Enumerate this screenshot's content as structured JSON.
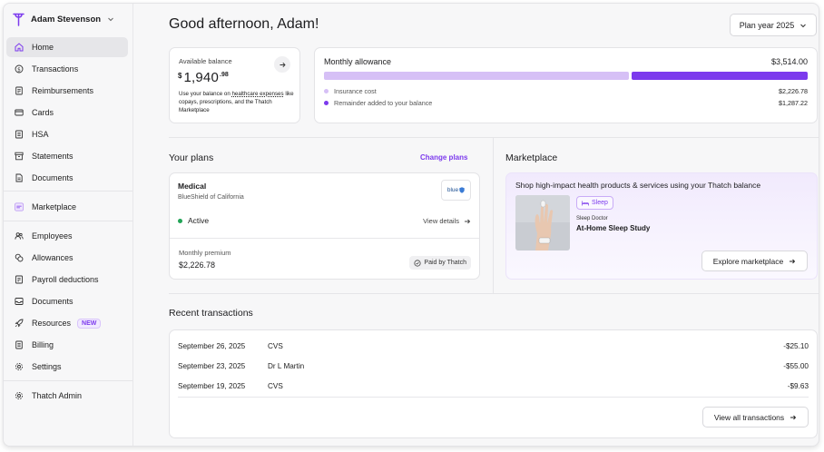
{
  "user": {
    "name": "Adam Stevenson"
  },
  "sidebar": {
    "group1": [
      {
        "label": "Home",
        "icon": "home-icon",
        "active": true
      },
      {
        "label": "Transactions",
        "icon": "dollar-circle-icon"
      },
      {
        "label": "Reimbursements",
        "icon": "receipt-icon"
      },
      {
        "label": "Cards",
        "icon": "card-icon"
      },
      {
        "label": "HSA",
        "icon": "hsa-icon"
      },
      {
        "label": "Statements",
        "icon": "archive-icon"
      },
      {
        "label": "Documents",
        "icon": "document-icon"
      }
    ],
    "group2": [
      {
        "label": "Marketplace",
        "icon": "marketplace-icon"
      }
    ],
    "group3": [
      {
        "label": "Employees",
        "icon": "users-icon"
      },
      {
        "label": "Allowances",
        "icon": "coins-icon"
      },
      {
        "label": "Payroll deductions",
        "icon": "payroll-icon"
      },
      {
        "label": "Documents",
        "icon": "inbox-icon"
      },
      {
        "label": "Resources",
        "icon": "rocket-icon",
        "badge": "NEW"
      },
      {
        "label": "Billing",
        "icon": "billing-icon"
      },
      {
        "label": "Settings",
        "icon": "gear-icon"
      }
    ],
    "group4": [
      {
        "label": "Thatch Admin",
        "icon": "admin-gear-icon"
      }
    ]
  },
  "header": {
    "greeting": "Good afternoon, Adam!",
    "plan_year": "Plan year 2025"
  },
  "balance": {
    "label": "Available balance",
    "currency": "$",
    "whole": "1,940",
    "cents": ".98",
    "desc_before": "Use your balance on ",
    "desc_link": "healthcare expenses",
    "desc_after": " like copays, prescriptions, and the Thatch Marketplace"
  },
  "allowance": {
    "title": "Monthly allowance",
    "total": "$3,514.00",
    "rows": [
      {
        "label": "Insurance cost",
        "value": "$2,226.78",
        "color": "#d6c0f6",
        "share": 0.634
      },
      {
        "label": "Remainder added to your balance",
        "value": "$1,287.22",
        "color": "#7c3aed",
        "share": 0.366
      }
    ]
  },
  "plans": {
    "title": "Your plans",
    "change_label": "Change plans",
    "plan": {
      "name": "Medical",
      "carrier": "BlueShield of California",
      "carrier_logo_text": "blue",
      "status": "Active",
      "view_details": "View details",
      "premium_label": "Monthly premium",
      "premium_value": "$2,226.78",
      "paid_by": "Paid by Thatch"
    }
  },
  "marketplace": {
    "title": "Marketplace",
    "headline": "Shop high-impact health products & services using your Thatch balance",
    "tag": "Sleep",
    "vendor": "Sleep Doctor",
    "product": "At-Home Sleep Study",
    "explore_label": "Explore marketplace"
  },
  "transactions": {
    "title": "Recent transactions",
    "rows": [
      {
        "date": "September 26, 2025",
        "merchant": "CVS",
        "amount": "-$25.10"
      },
      {
        "date": "September 23, 2025",
        "merchant": "Dr L Martin",
        "amount": "-$55.00"
      },
      {
        "date": "September 19, 2025",
        "merchant": "CVS",
        "amount": "-$9.63"
      }
    ],
    "view_all_label": "View all transactions"
  },
  "colors": {
    "accent": "#7c3aed",
    "accent_light": "#d6c0f6",
    "status_active": "#22a456"
  }
}
